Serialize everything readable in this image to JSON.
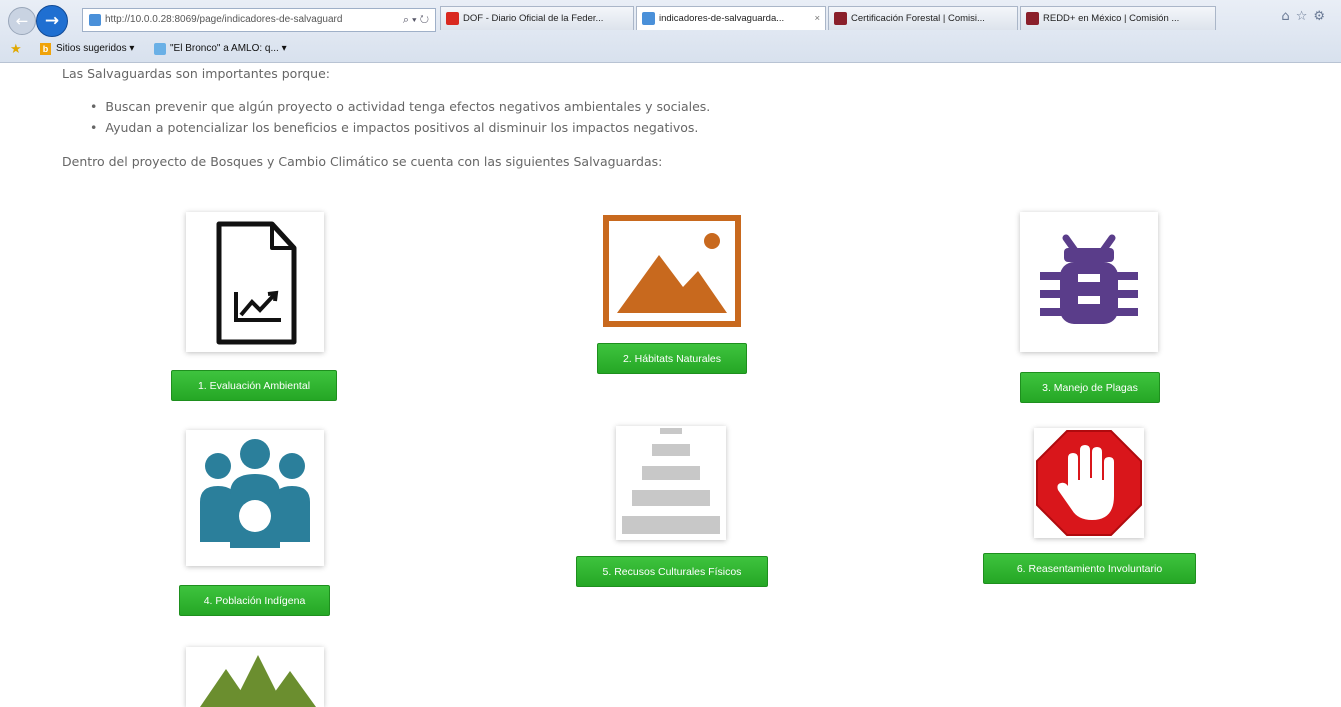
{
  "browser": {
    "address": "http://10.0.0.28:8069/page/indicadores-de-salvaguard",
    "address_controls": "⌕ ▾ ↻",
    "tabs": [
      {
        "label": "DOF - Diario Oficial de la Feder...",
        "icon_color": "#d9281f",
        "active": false
      },
      {
        "label": "indicadores-de-salvaguarda...",
        "icon_color": "#4a90d9",
        "active": true
      },
      {
        "label": "Certificación Forestal | Comisi...",
        "icon_color": "#8a1f2a",
        "active": false
      },
      {
        "label": "REDD+ en México | Comisión ...",
        "icon_color": "#8a1f2a",
        "active": false
      }
    ],
    "tab_close": "×",
    "favorites": [
      {
        "label": "Sitios sugeridos ▾",
        "icon": "bing-icon"
      },
      {
        "label": "\"El Bronco\" a AMLO: q... ▾",
        "icon": "page-icon"
      }
    ],
    "toolbar_icons": [
      "home-icon",
      "star-icon",
      "gear-icon"
    ]
  },
  "content": {
    "intro": "Las Salvaguardas son importantes porque:",
    "bullets": [
      "Buscan prevenir que algún proyecto o actividad tenga efectos negativos ambientales y sociales.",
      "Ayudan a potencializar los beneficios e impactos positivos al disminuir los impactos negativos."
    ],
    "within": "Dentro del proyecto de Bosques y Cambio Climático se cuenta con las siguientes Salvaguardas:"
  },
  "safeguards": [
    {
      "label": "1. Evaluación Ambiental",
      "icon": "document-chart-icon"
    },
    {
      "label": "2. Hábitats Naturales",
      "icon": "landscape-image-icon"
    },
    {
      "label": "3. Manejo de Plagas",
      "icon": "bug-icon"
    },
    {
      "label": "4. Población Indígena",
      "icon": "people-group-icon"
    },
    {
      "label": "5. Recusos Culturales Físicos",
      "icon": "pyramid-icon"
    },
    {
      "label": "6. Reasentamiento Involuntario",
      "icon": "stop-hand-icon"
    },
    {
      "label": "",
      "icon": "mountains-icon"
    }
  ],
  "colors": {
    "button_green": "#2fb52f",
    "habitat_orange": "#c8691e",
    "bug_purple": "#5a3d8a",
    "people_teal": "#2b7f9b",
    "pyramid_gray": "#c8c8c8",
    "stop_red": "#d9161b",
    "mountain_green": "#6b8e2f"
  }
}
